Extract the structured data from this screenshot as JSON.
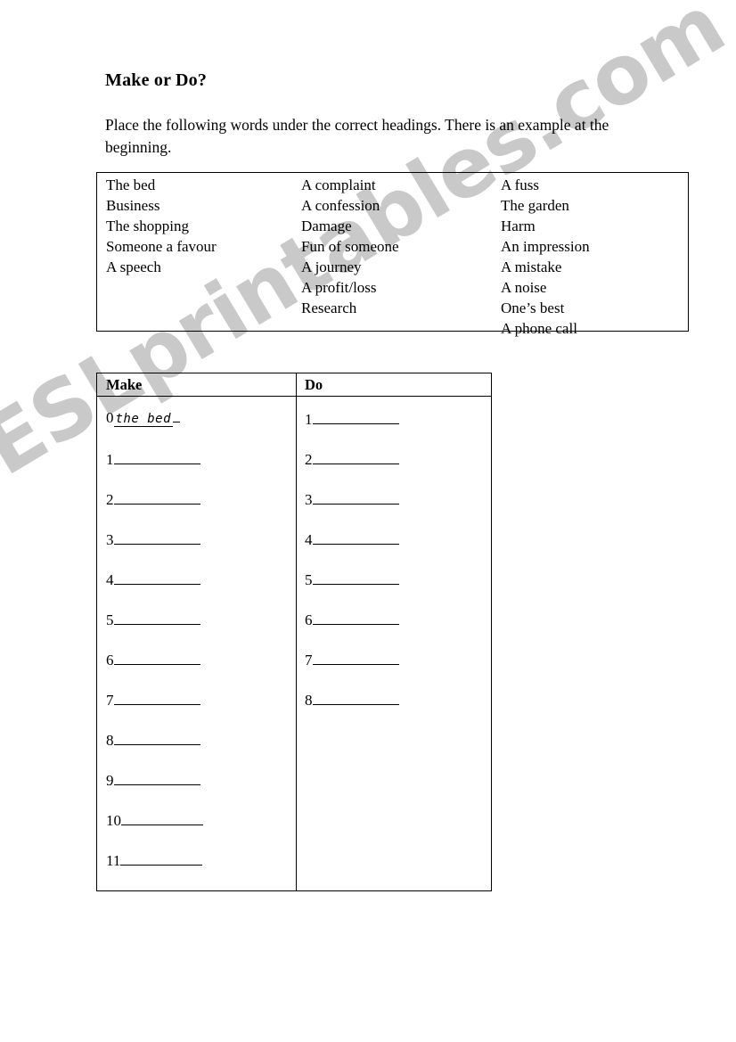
{
  "page": {
    "title": "Make or Do?",
    "instructions": "Place the following words under the correct headings. There is an example at the beginning."
  },
  "watermark": {
    "text": "ESLprintables.com",
    "color": "#c9c9c9"
  },
  "word_bank": {
    "columns": [
      {
        "items": [
          "The bed",
          "Business",
          "The shopping",
          "Someone a favour",
          "A speech"
        ]
      },
      {
        "items": [
          "A complaint",
          "A confession",
          "Damage",
          "Fun of someone",
          "A journey",
          "A profit/loss",
          "Research"
        ]
      },
      {
        "items": [
          "A fuss",
          "The garden",
          "Harm",
          "An impression",
          "A mistake",
          "A noise",
          "One’s best",
          "A phone call"
        ]
      }
    ]
  },
  "answer_table": {
    "headers": {
      "make": "Make",
      "do": "Do"
    },
    "make_column": {
      "example": {
        "number": "0",
        "answer": "the bed"
      },
      "numbers": [
        "1",
        "2",
        "3",
        "4",
        "5",
        "6",
        "7",
        "8",
        "9",
        "10",
        "11"
      ]
    },
    "do_column": {
      "numbers": [
        "1",
        "2",
        "3",
        "4",
        "5",
        "6",
        "7",
        "8"
      ]
    }
  }
}
